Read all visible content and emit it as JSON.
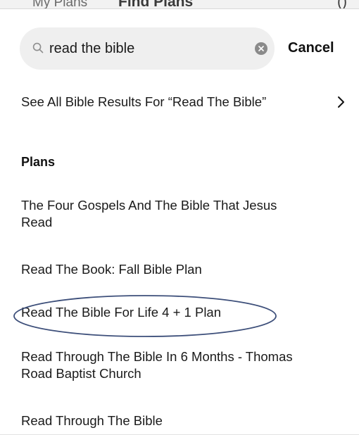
{
  "underlying_tabs": {
    "my_plans": "My Plans",
    "find_plans": "Find Plans",
    "corner_glyph": "()"
  },
  "search": {
    "value": "read the bible",
    "cancel_label": "Cancel"
  },
  "see_all_results": "See All Bible Results For “Read The Bible”",
  "plans": {
    "header": "Plans",
    "items": [
      "The Four Gospels And The Bible That Jesus Read",
      "Read The Book: Fall Bible Plan",
      "Read The Bible For Life 4 + 1 Plan",
      "Read Through The Bible In 6 Months - Thomas Road Baptist Church",
      "Read Through The Bible"
    ]
  },
  "annotation": {
    "highlighted_item": "Read The Bible For Life 4 + 1 Plan",
    "shape": "ellipse",
    "color": "#3d4f7a"
  },
  "icons": {
    "search": "search-icon",
    "clear": "clear-icon",
    "chevron": "chevron-right-icon"
  },
  "colors": {
    "search_bg": "#efefef",
    "text": "#111111",
    "clear_button": "#8a8a8a"
  }
}
